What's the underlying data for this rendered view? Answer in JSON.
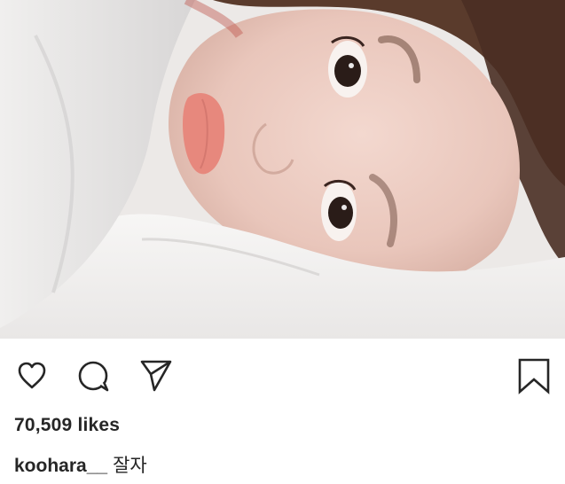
{
  "post": {
    "actions": {
      "like_icon": "heart-outline-icon",
      "comment_icon": "comment-bubble-icon",
      "share_icon": "paper-plane-icon",
      "save_icon": "bookmark-outline-icon"
    },
    "likes_text": "70,509 likes",
    "caption": {
      "username": "koohara__",
      "text": "잘자"
    }
  }
}
